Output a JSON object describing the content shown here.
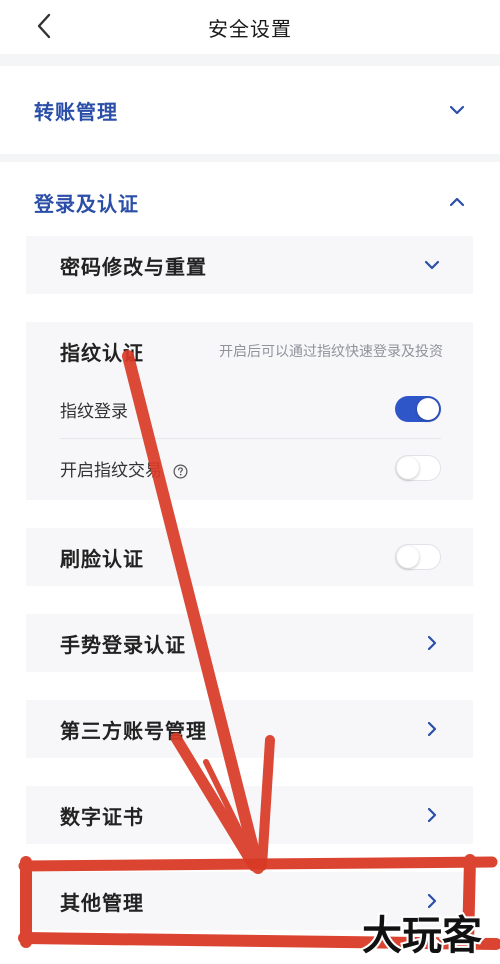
{
  "header": {
    "title": "安全设置"
  },
  "sections": {
    "transfer": {
      "label": "转账管理"
    },
    "login": {
      "label": "登录及认证"
    }
  },
  "items": {
    "password": {
      "label": "密码修改与重置"
    },
    "fingerprint": {
      "label": "指纹认证",
      "hint": "开启后可以通过指纹快速登录及投资",
      "login_label": "指纹登录",
      "login_on": true,
      "trade_label": "开启指纹交易",
      "trade_on": false
    },
    "face": {
      "label": "刷脸认证",
      "on": false
    },
    "gesture": {
      "label": "手势登录认证"
    },
    "third_party": {
      "label": "第三方账号管理"
    },
    "certificate": {
      "label": "数字证书"
    },
    "other": {
      "label": "其他管理"
    }
  },
  "watermark": {
    "text": "大玩客"
  },
  "colors": {
    "accent": "#2f56c8",
    "section_text": "#2b4ea8",
    "annotation_red": "#d93a26"
  },
  "icons": {
    "back": "chevron-left-icon",
    "expand": "chevron-down-icon",
    "collapse": "chevron-up-icon",
    "go": "chevron-right-icon",
    "help": "question-circle-icon"
  }
}
